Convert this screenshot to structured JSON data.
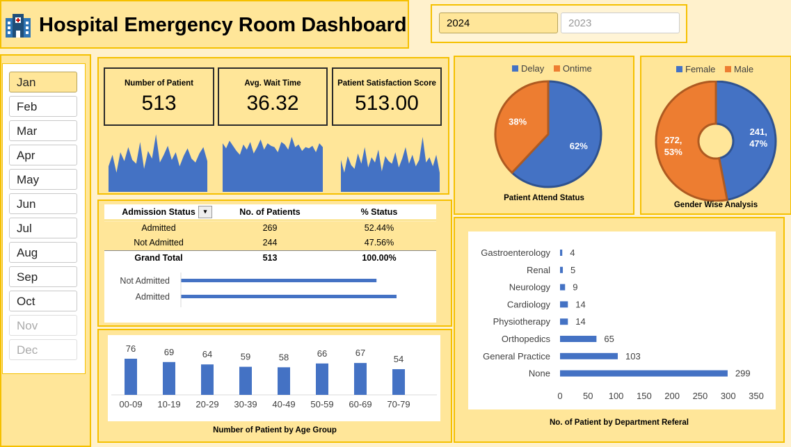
{
  "header": {
    "title": "Hospital Emergency Room Dashboard"
  },
  "years": [
    {
      "label": "2024",
      "selected": true
    },
    {
      "label": "2023",
      "selected": false
    }
  ],
  "months": [
    {
      "label": "Jan",
      "state": "selected"
    },
    {
      "label": "Feb",
      "state": "normal"
    },
    {
      "label": "Mar",
      "state": "normal"
    },
    {
      "label": "Apr",
      "state": "normal"
    },
    {
      "label": "May",
      "state": "normal"
    },
    {
      "label": "Jun",
      "state": "normal"
    },
    {
      "label": "Jul",
      "state": "normal"
    },
    {
      "label": "Aug",
      "state": "normal"
    },
    {
      "label": "Sep",
      "state": "normal"
    },
    {
      "label": "Oct",
      "state": "normal"
    },
    {
      "label": "Nov",
      "state": "disabled"
    },
    {
      "label": "Dec",
      "state": "disabled"
    }
  ],
  "kpis": [
    {
      "label": "Number of Patient",
      "value": "513"
    },
    {
      "label": "Avg. Wait Time",
      "value": "36.32"
    },
    {
      "label": "Patient Satisfaction Score",
      "value": "513.00"
    }
  ],
  "admission_table": {
    "headers": [
      "Admission Status",
      "No. of Patients",
      "% Status"
    ],
    "rows": [
      {
        "status": "Admitted",
        "count": "269",
        "pct": "52.44%"
      },
      {
        "status": "Not Admitted",
        "count": "244",
        "pct": "47.56%"
      }
    ],
    "total": {
      "status": "Grand Total",
      "count": "513",
      "pct": "100.00%"
    }
  },
  "colors": {
    "blue": "#4472c4",
    "orange": "#ed7d31",
    "panel": "#ffe699",
    "border": "#f5c000",
    "background": "#fff1cc"
  },
  "chart_data": [
    {
      "type": "area",
      "id": "sparkline-patients",
      "y": [
        40,
        58,
        30,
        62,
        48,
        70,
        50,
        44,
        78,
        36,
        64,
        52,
        90,
        46,
        58,
        72,
        50,
        62,
        40,
        56,
        68,
        52,
        46,
        60,
        70,
        48
      ]
    },
    {
      "type": "area",
      "id": "sparkline-wait",
      "y": [
        76,
        68,
        80,
        72,
        64,
        58,
        74,
        66,
        78,
        60,
        70,
        82,
        66,
        76,
        72,
        70,
        62,
        78,
        74,
        66,
        86,
        70,
        74,
        64,
        70,
        68,
        72,
        62,
        76,
        70
      ]
    },
    {
      "type": "area",
      "id": "sparkline-satisfaction",
      "y": [
        50,
        30,
        56,
        42,
        36,
        60,
        44,
        70,
        38,
        54,
        46,
        66,
        32,
        56,
        48,
        44,
        62,
        38,
        52,
        70,
        44,
        58,
        40,
        50,
        86,
        46,
        54,
        40,
        58,
        30
      ]
    },
    {
      "type": "bar",
      "id": "admission-bars",
      "orientation": "horizontal",
      "categories": [
        "Not Admitted",
        "Admitted"
      ],
      "values": [
        244,
        269
      ]
    },
    {
      "type": "pie",
      "id": "attend-pie",
      "title": "Patient Attend Status",
      "labels": [
        "Delay",
        "Ontime"
      ],
      "values": [
        62,
        38
      ],
      "data_labels": [
        "62%",
        "38%"
      ],
      "legend": "top"
    },
    {
      "type": "pie",
      "id": "gender-donut",
      "title": "Gender Wise Analysis",
      "labels": [
        "Female",
        "Male"
      ],
      "values": [
        241,
        272
      ],
      "data_labels": [
        "241,\n47%",
        "272,\n53%"
      ],
      "legend": "top"
    },
    {
      "type": "bar",
      "id": "age-bars",
      "title": "Number of Patient by Age Group",
      "categories": [
        "00-09",
        "10-19",
        "20-29",
        "30-39",
        "40-49",
        "50-59",
        "60-69",
        "70-79"
      ],
      "values": [
        76,
        69,
        64,
        59,
        58,
        66,
        67,
        54
      ]
    },
    {
      "type": "bar",
      "id": "dept-bars",
      "orientation": "horizontal",
      "title": "No. of Patient by Department Referal",
      "categories": [
        "Gastroenterology",
        "Renal",
        "Neurology",
        "Cardiology",
        "Physiotherapy",
        "Orthopedics",
        "General Practice",
        "None"
      ],
      "values": [
        4,
        5,
        9,
        14,
        14,
        65,
        103,
        299
      ],
      "xticks": [
        "0",
        "50",
        "100",
        "150",
        "200",
        "250",
        "300",
        "350"
      ],
      "xlim": [
        0,
        350
      ]
    }
  ]
}
